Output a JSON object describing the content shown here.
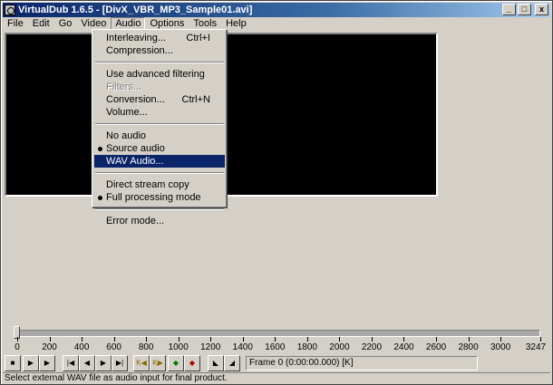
{
  "window": {
    "title": "VirtualDub 1.6.5 - [DivX_VBR_MP3_Sample01.avi]",
    "buttons": {
      "minimize": "_",
      "maximize": "□",
      "close": "x"
    }
  },
  "menubar": {
    "items": [
      "File",
      "Edit",
      "Go",
      "Video",
      "Audio",
      "Options",
      "Tools",
      "Help"
    ],
    "active": "Audio"
  },
  "audio_menu": {
    "items": [
      {
        "label": "Interleaving...",
        "shortcut": "Ctrl+I"
      },
      {
        "label": "Compression..."
      },
      {
        "label": "Use advanced filtering"
      },
      {
        "label": "Filters...",
        "disabled": true
      },
      {
        "label": "Conversion...",
        "shortcut": "Ctrl+N"
      },
      {
        "label": "Volume..."
      },
      {
        "label": "No audio"
      },
      {
        "label": "Source audio",
        "checked": true
      },
      {
        "label": "WAV Audio...",
        "highlighted": true
      },
      {
        "label": "Direct stream copy"
      },
      {
        "label": "Full processing mode",
        "checked": true
      },
      {
        "label": "Error mode..."
      }
    ]
  },
  "timeline": {
    "ticks": [
      "0",
      "200",
      "400",
      "600",
      "800",
      "1000",
      "1200",
      "1400",
      "1600",
      "1800",
      "2000",
      "2200",
      "2400",
      "2600",
      "2800",
      "3000",
      "3247"
    ],
    "position": 0,
    "max": 3247
  },
  "toolbar": {
    "icons": [
      "stop-icon",
      "play-input-icon",
      "play-output-icon",
      "go-start-icon",
      "prev-frame-icon",
      "next-frame-icon",
      "go-end-icon",
      "prev-keyframe-icon",
      "next-keyframe-icon",
      "prev-scene-icon",
      "next-scene-icon",
      "mark-in-icon",
      "mark-out-icon"
    ]
  },
  "frame_display": "Frame 0 (0:00:00.000) [K]",
  "status_text": "Select external WAV file as audio input for final product.",
  "colors": {
    "highlight": "#0a246a",
    "titlebar": "#0a246a",
    "face": "#d4d0c8"
  }
}
